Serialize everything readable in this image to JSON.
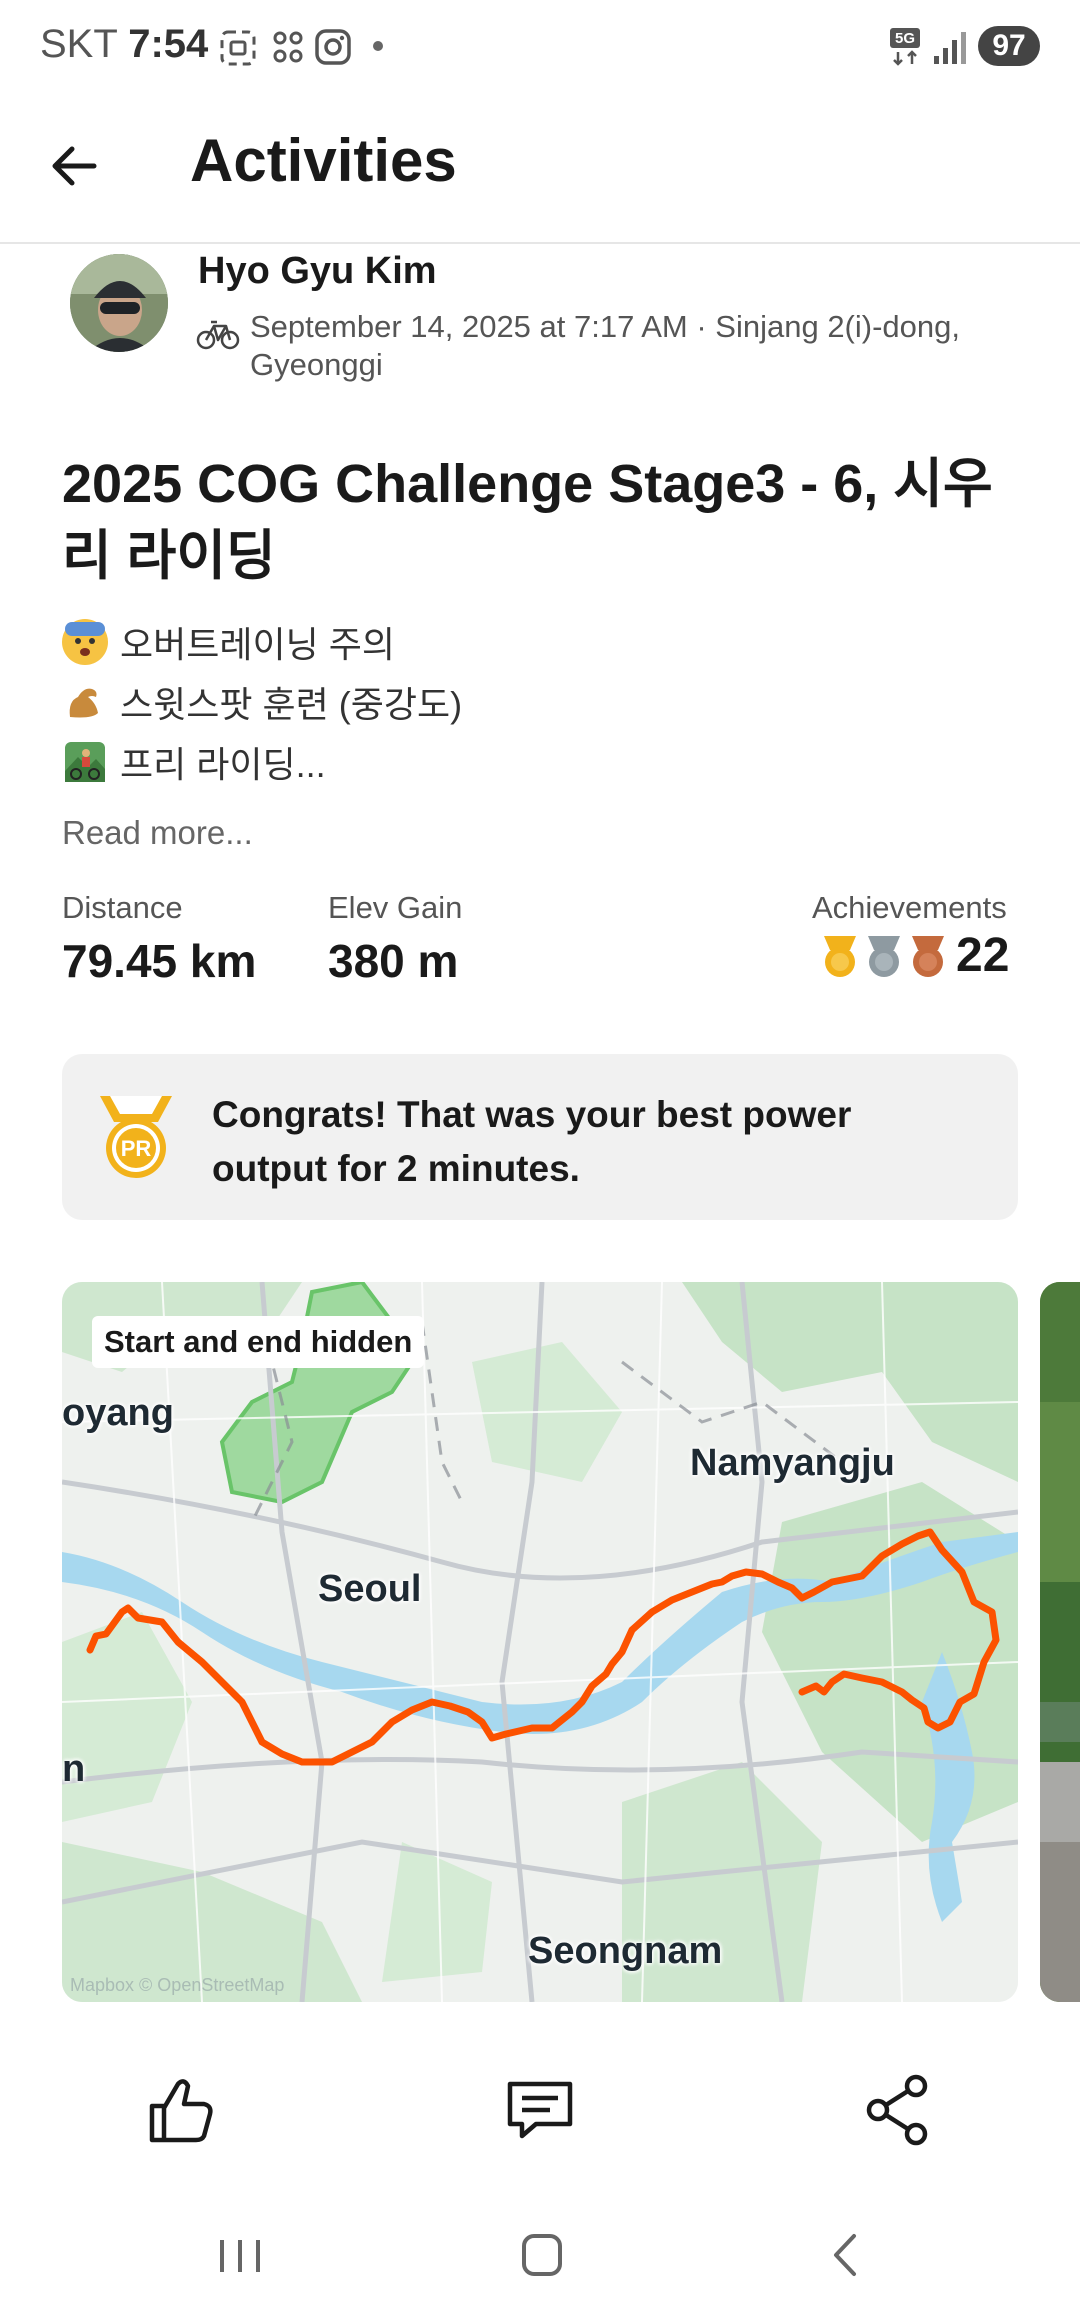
{
  "status_bar": {
    "carrier": "SKT",
    "time": "7:54",
    "battery": "97"
  },
  "header": {
    "title": "Activities"
  },
  "activity": {
    "author": "Hyo Gyu Kim",
    "meta": "September 14, 2025 at 7:17 AM · Sinjang 2(i)-dong, Gyeonggi",
    "title": "2025 COG Challenge Stage3 - 6, 시우리 라이딩",
    "description": [
      {
        "emoji_icon": "fearful-face-icon",
        "text": "오버트레이닝 주의"
      },
      {
        "emoji_icon": "flexed-arm-icon",
        "text": "스윗스팟 훈련 (중강도)"
      },
      {
        "emoji_icon": "mountain-biker-icon",
        "text": "프리 라이딩..."
      }
    ],
    "read_more": "Read more...",
    "stats": {
      "distance_label": "Distance",
      "distance_value": "79.45 km",
      "elev_label": "Elev Gain",
      "elev_value": "380 m",
      "achievements_label": "Achievements",
      "achievements_value": "22"
    },
    "pr_card": {
      "text": "Congrats! That was your best power output for 2 minutes.",
      "badge": "PR"
    },
    "map": {
      "chip": "Start and end hidden",
      "labels": [
        "oyang",
        "Namyangju",
        "Seoul",
        "n",
        "Seongnam"
      ],
      "attribution": "Mapbox © OpenStreetMap",
      "route_color": "#fc5200"
    }
  },
  "actions": {
    "like_icon": "thumbs-up-icon",
    "comment_icon": "comment-icon",
    "share_icon": "share-icon"
  },
  "colors": {
    "accent": "#fc5200",
    "gold": "#f2b21b",
    "silver": "#8e9aa1",
    "bronze": "#c46a3d"
  }
}
